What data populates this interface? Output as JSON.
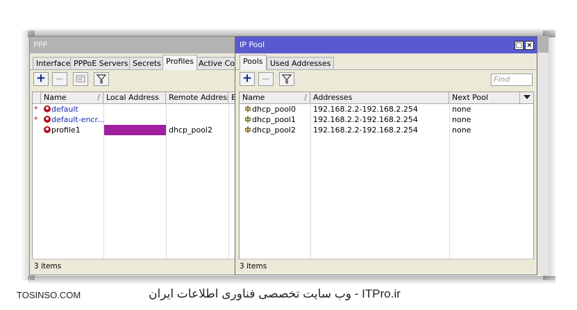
{
  "ppp": {
    "title": "PPP",
    "tabs": [
      "Interface",
      "PPPoE Servers",
      "Secrets",
      "Profiles",
      "Active Conn"
    ],
    "active_tab": "Profiles",
    "columns": [
      "Name",
      "Local Address",
      "Remote Address",
      "Br"
    ],
    "sort_marker": "/",
    "rows": [
      {
        "flag": "*",
        "name": "default",
        "local": "",
        "remote": ""
      },
      {
        "flag": "*",
        "name": "default-encr...",
        "local": "",
        "remote": ""
      },
      {
        "flag": "",
        "name": "profile1",
        "local": "",
        "remote": "dhcp_pool2"
      }
    ],
    "redaction_color": "#a020a0",
    "status": "3 items"
  },
  "pool": {
    "title": "IP Pool",
    "tabs": [
      "Pools",
      "Used Addresses"
    ],
    "active_tab": "Pools",
    "find_placeholder": "Find",
    "columns": [
      "Name",
      "Addresses",
      "Next Pool"
    ],
    "sort_marker": "/",
    "rows": [
      {
        "name": "dhcp_pool0",
        "addresses": "192.168.2.2-192.168.2.254",
        "next": "none"
      },
      {
        "name": "dhcp_pool1",
        "addresses": "192.168.2.2-192.168.2.254",
        "next": "none"
      },
      {
        "name": "dhcp_pool2",
        "addresses": "192.168.2.2-192.168.2.254",
        "next": "none"
      }
    ],
    "status": "3 items"
  },
  "icons": {
    "add": "plus-icon",
    "remove": "minus-icon",
    "comment": "comment-icon",
    "filter": "filter-icon",
    "profile": "profile-icon",
    "pool": "pool-icon",
    "restore": "restore-icon",
    "close": "close-icon"
  },
  "colors": {
    "pool_titlebar": "#5a5ad0",
    "ppp_titlebar": "#b3b3b3",
    "profile_icon": "#b01020"
  },
  "footer": {
    "left": "TOSINSO.COM",
    "right": "ITPro.ir - وب سایت تخصصی فناوری اطلاعات ایران"
  }
}
